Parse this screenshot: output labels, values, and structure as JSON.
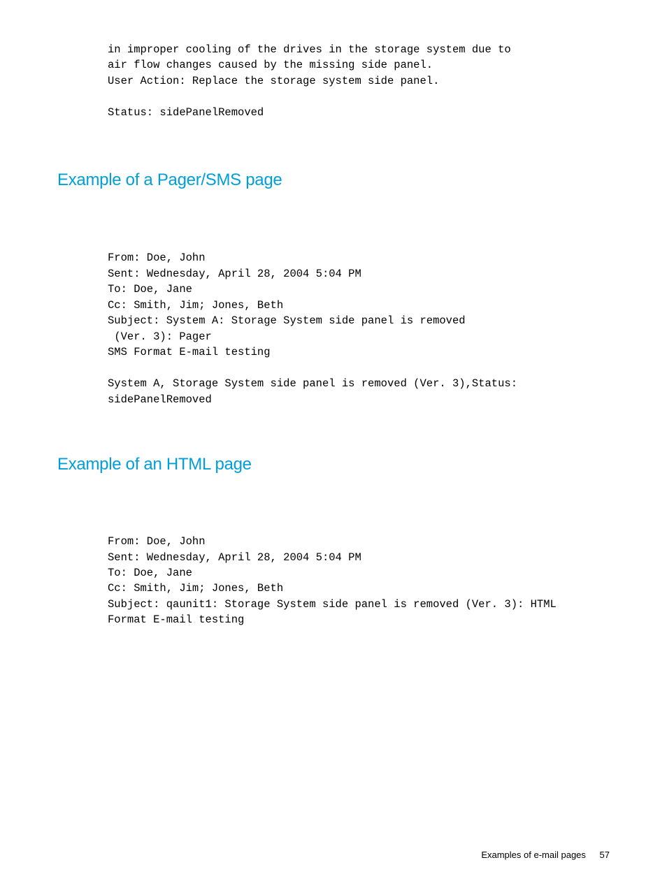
{
  "intro": {
    "line1": "in improper cooling of the drives in the storage system due to",
    "line2": "air flow changes caused by the missing side panel.",
    "line3": "User Action: Replace the storage system side panel.",
    "blank": "",
    "line4": "Status: sidePanelRemoved"
  },
  "heading1": "Example of a Pager/SMS page",
  "pager": {
    "l1": "From: Doe, John",
    "l2": "Sent: Wednesday, April 28, 2004 5:04 PM",
    "l3": "To: Doe, Jane",
    "l4": "Cc: Smith, Jim; Jones, Beth",
    "l5": "Subject: System A: Storage System side panel is removed",
    "l6": " (Ver. 3): Pager",
    "l7": "SMS Format E-mail testing",
    "blank": "",
    "l8": "System A, Storage System side panel is removed (Ver. 3),Status:",
    "l9": "sidePanelRemoved"
  },
  "heading2": "Example of an HTML page",
  "html": {
    "l1": "From: Doe, John",
    "l2": "Sent: Wednesday, April 28, 2004 5:04 PM",
    "l3": "To: Doe, Jane",
    "l4": "Cc: Smith, Jim; Jones, Beth",
    "l5": "Subject: qaunit1: Storage System side panel is removed (Ver. 3): HTML",
    "l6": "Format E-mail testing"
  },
  "footer": {
    "label": "Examples of e-mail pages",
    "page": "57"
  }
}
